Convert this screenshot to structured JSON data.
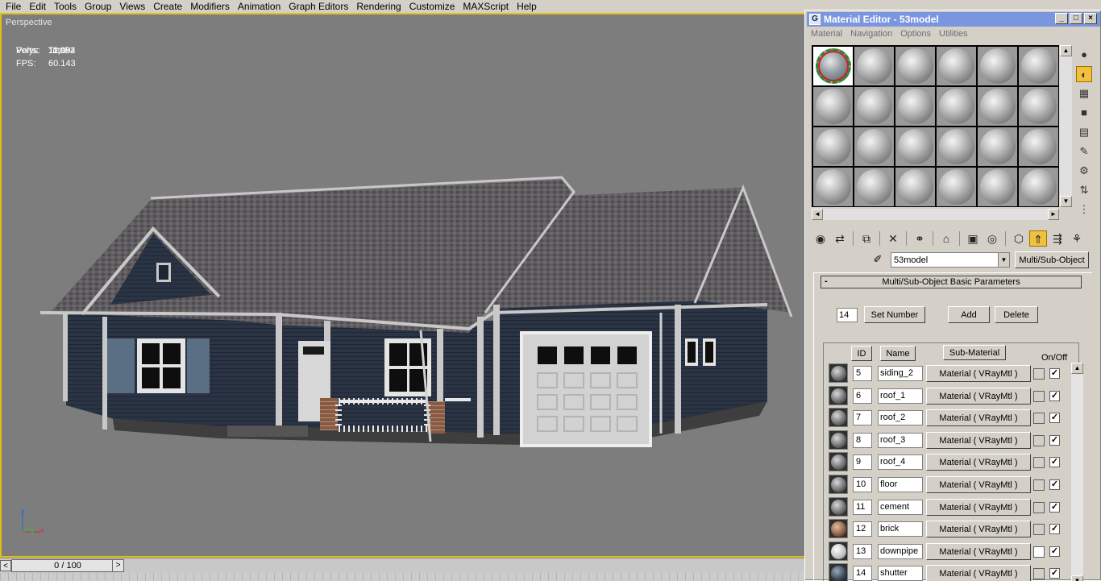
{
  "menu": [
    "File",
    "Edit",
    "Tools",
    "Group",
    "Views",
    "Create",
    "Modifiers",
    "Animation",
    "Graph Editors",
    "Rendering",
    "Customize",
    "MAXScript",
    "Help"
  ],
  "viewport": {
    "label": "Perspective",
    "stats": {
      "header": "Total",
      "polys_label": "Polys:",
      "polys": "11,082",
      "verts_label": "Verts:",
      "verts": "12,994",
      "fps_label": "FPS:",
      "fps": "60.143"
    },
    "axis": {
      "z": "z",
      "y": "y",
      "x": "x"
    }
  },
  "timeline": {
    "frame": "0 / 100",
    "left_arrow": "<",
    "right_arrow": ">"
  },
  "material_editor": {
    "title": "Material Editor - 53model",
    "menu": [
      "Material",
      "Navigation",
      "Options",
      "Utilities"
    ],
    "window_buttons": [
      "_",
      "□",
      "×"
    ],
    "material_name": "53model",
    "material_type": "Multi/Sub-Object",
    "rollout_title": "Multi/Sub-Object Basic Parameters",
    "rollout_toggle": "-",
    "count": "14",
    "buttons": {
      "set_number": "Set Number",
      "add": "Add",
      "delete": "Delete"
    },
    "columns": {
      "id": "ID",
      "name": "Name",
      "sub_material": "Sub-Material",
      "on_off": "On/Off"
    },
    "rows": [
      {
        "id": "5",
        "name": "siding_2",
        "material": "Material ( VRayMtl )",
        "on": "✓"
      },
      {
        "id": "6",
        "name": "roof_1",
        "material": "Material ( VRayMtl )",
        "on": "✓"
      },
      {
        "id": "7",
        "name": "roof_2",
        "material": "Material ( VRayMtl )",
        "on": "✓"
      },
      {
        "id": "8",
        "name": "roof_3",
        "material": "Material ( VRayMtl )",
        "on": "✓"
      },
      {
        "id": "9",
        "name": "roof_4",
        "material": "Material ( VRayMtl )",
        "on": "✓"
      },
      {
        "id": "10",
        "name": "floor",
        "material": "Material ( VRayMtl )",
        "on": "✓"
      },
      {
        "id": "11",
        "name": "cement",
        "material": "Material ( VRayMtl )",
        "on": "✓"
      },
      {
        "id": "12",
        "name": "brick",
        "material": "Material ( VRayMtl )",
        "on": "✓"
      },
      {
        "id": "13",
        "name": "downpipe",
        "material": "Material ( VRayMtl )",
        "on": "✓"
      },
      {
        "id": "14",
        "name": "shutter",
        "material": "Material ( VRayMtl )",
        "on": "✓"
      }
    ]
  }
}
